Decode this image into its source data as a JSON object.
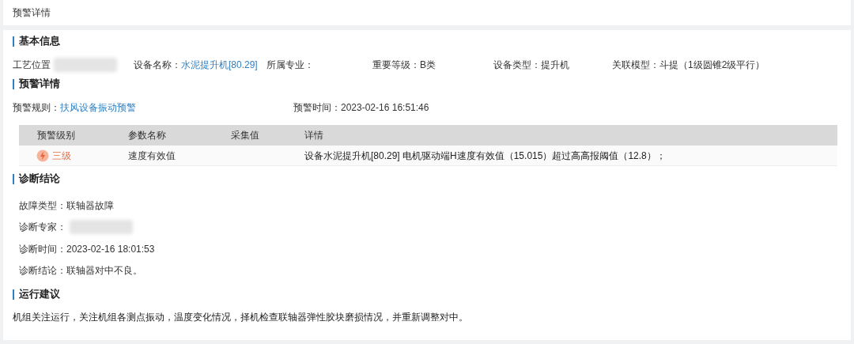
{
  "page_title": "预警详情",
  "basic_info": {
    "heading": "基本信息",
    "fields": [
      {
        "label": "工艺位置",
        "kind": "blurred"
      },
      {
        "label": "设备名称：",
        "value": "水泥提升机[80.29]",
        "kind": "link"
      },
      {
        "label": "所属专业：",
        "kind": "empty"
      },
      {
        "label": "重要等级：",
        "value": "B类",
        "kind": "text"
      },
      {
        "label": "设备类型：",
        "value": "提升机",
        "kind": "text"
      },
      {
        "label": "关联模型：",
        "value": "斗提（1级圆锥2级平行）",
        "kind": "text"
      }
    ]
  },
  "warning": {
    "heading": "预警详情",
    "rule_label": "预警规则：",
    "rule": "扶风设备振动预警",
    "time_label": "预警时间：",
    "time": "2023-02-16 16:51:46",
    "table": {
      "columns": [
        "预警级别",
        "参数名称",
        "采集值",
        "详情"
      ],
      "rows": [
        {
          "level": "三级",
          "parameter": "速度有效值",
          "detail": "设备水泥提升机[80.29] 电机驱动端H速度有效值（15.015）超过高高报阈值（12.8）；"
        }
      ]
    }
  },
  "diagnosis": {
    "heading": "诊断结论",
    "fields": [
      {
        "label": "故障类型：",
        "value": "联轴器故障",
        "kind": "text"
      },
      {
        "label": "诊断专家：",
        "kind": "blurred"
      },
      {
        "label": "诊断时间：",
        "value": "2023-02-16 18:01:53",
        "kind": "text"
      },
      {
        "label": "诊断结论：",
        "value": "联轴器对中不良。",
        "kind": "text"
      }
    ]
  },
  "advice": {
    "heading": "运行建议",
    "text": "机组关注运行，关注机组各测点振动，温度变化情况，择机检查联轴器弹性胶块磨损情况，并重新调整对中。"
  }
}
